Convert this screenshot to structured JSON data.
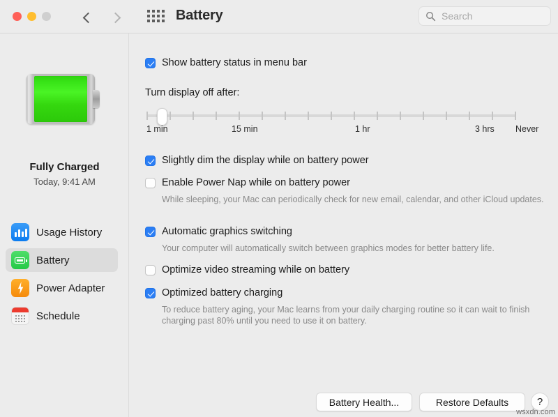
{
  "window": {
    "title": "Battery",
    "traffic_lights": [
      "close",
      "minimize",
      "zoom"
    ],
    "back_icon": "chevron-left-icon",
    "forward_icon": "chevron-right-icon",
    "grid_icon": "show-all-grid-icon"
  },
  "search": {
    "placeholder": "Search",
    "value": "",
    "icon": "search-icon"
  },
  "sidebar": {
    "battery_icon": "battery-full-graphic",
    "charge_status": "Fully Charged",
    "charge_time": "Today, 9:41 AM",
    "items": [
      {
        "label": "Usage History",
        "icon": "bar-chart-icon",
        "selected": false
      },
      {
        "label": "Battery",
        "icon": "battery-icon",
        "selected": true
      },
      {
        "label": "Power Adapter",
        "icon": "lightning-bolt-icon",
        "selected": false
      },
      {
        "label": "Schedule",
        "icon": "calendar-icon",
        "selected": false
      }
    ]
  },
  "main": {
    "menu_bar_checkbox": {
      "label": "Show battery status in menu bar",
      "checked": true
    },
    "display_off": {
      "label": "Turn display off after:",
      "slider": {
        "value_index": 1,
        "tick_count": 17,
        "tick_labels": [
          "1 min",
          "15 min",
          "1 hr",
          "3 hrs",
          "Never"
        ]
      }
    },
    "options": [
      {
        "label": "Slightly dim the display while on battery power",
        "checked": true,
        "description": ""
      },
      {
        "label": "Enable Power Nap while on battery power",
        "checked": false,
        "description": "While sleeping, your Mac can periodically check for new email, calendar, and other iCloud updates."
      },
      {
        "label": "Automatic graphics switching",
        "checked": true,
        "description": "Your computer will automatically switch between graphics modes for better battery life."
      },
      {
        "label": "Optimize video streaming while on battery",
        "checked": false,
        "description": ""
      },
      {
        "label": "Optimized battery charging",
        "checked": true,
        "description": "To reduce battery aging, your Mac learns from your daily charging routine so it can wait to finish charging past 80% until you need to use it on battery."
      }
    ],
    "buttons": {
      "battery_health": "Battery Health...",
      "restore_defaults": "Restore Defaults",
      "help": "?"
    }
  },
  "watermark": "wsxdn.com",
  "colors": {
    "accent": "#2b7ef4",
    "battery_green": "#35d80f",
    "window_bg": "#ececec",
    "selected_row": "#dcdcdc"
  }
}
